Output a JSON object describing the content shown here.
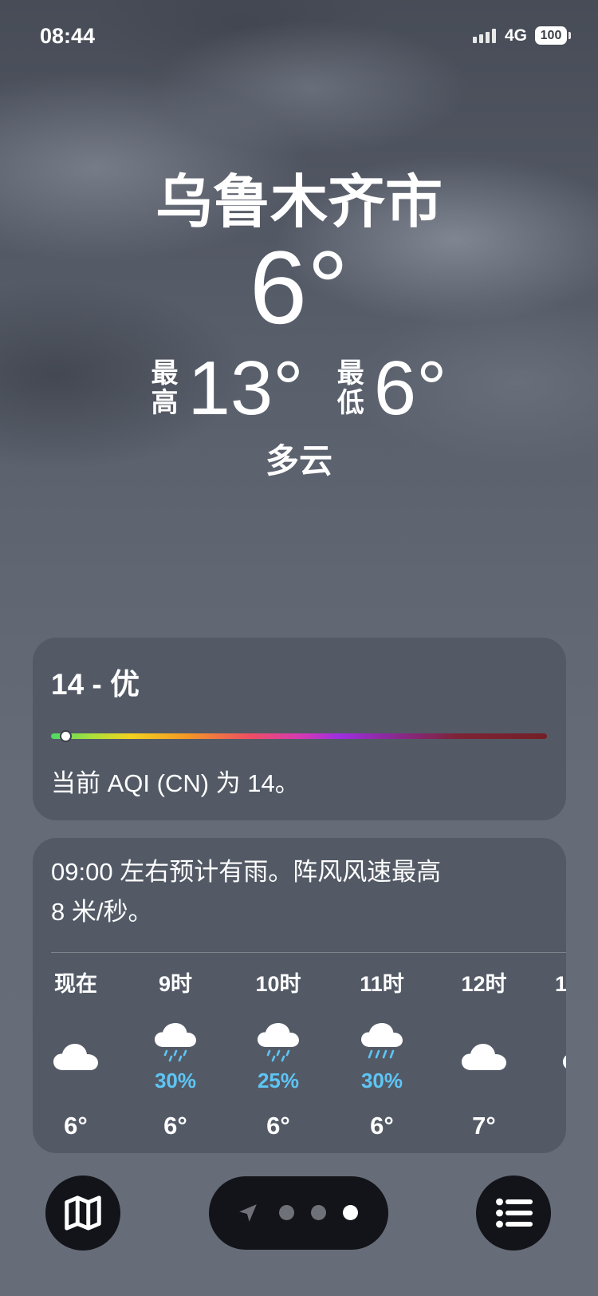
{
  "status_bar": {
    "time": "08:44",
    "signal_bars": 4,
    "network": "4G",
    "battery": "100"
  },
  "current": {
    "city": "乌鲁木齐市",
    "temperature": "6°",
    "high_label": [
      "最",
      "高"
    ],
    "high": "13°",
    "low_label": [
      "最",
      "低"
    ],
    "low": "6°",
    "condition": "多云"
  },
  "aqi": {
    "title": "14 - 优",
    "indicator_fraction": 0.03,
    "description": "当前 AQI (CN) 为 14。"
  },
  "hourly": {
    "summary": [
      "09:00 左右预计有雨。阵风风速最高",
      "8 米/秒。"
    ],
    "items": [
      {
        "label": "现在",
        "icon": "cloud-icon",
        "precip": "",
        "temp": "6°"
      },
      {
        "label": "9时",
        "icon": "cloud-rain-icon",
        "precip": "30%",
        "temp": "6°"
      },
      {
        "label": "10时",
        "icon": "cloud-rain-icon",
        "precip": "25%",
        "temp": "6°"
      },
      {
        "label": "11时",
        "icon": "cloud-heavy-rain-icon",
        "precip": "30%",
        "temp": "6°"
      },
      {
        "label": "12时",
        "icon": "cloud-icon",
        "precip": "",
        "temp": "7°"
      },
      {
        "label": "1",
        "icon": "cloud-icon"
      }
    ]
  },
  "bottom_bar": {
    "map_icon": "map-icon",
    "list_icon": "list-icon",
    "location_icon": "location-arrow-icon",
    "dot_count": 3,
    "active_dot": 2
  },
  "colors": {
    "precip": "#5ec5f5",
    "card": "#535a66",
    "button": "#121419"
  }
}
